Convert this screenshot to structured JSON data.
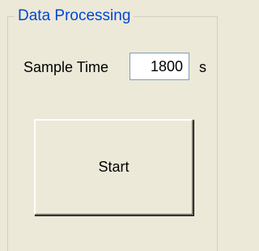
{
  "group": {
    "title": "Data Processing"
  },
  "sample_time": {
    "label": "Sample Time",
    "value": "1800",
    "unit": "s"
  },
  "actions": {
    "start_label": "Start"
  }
}
